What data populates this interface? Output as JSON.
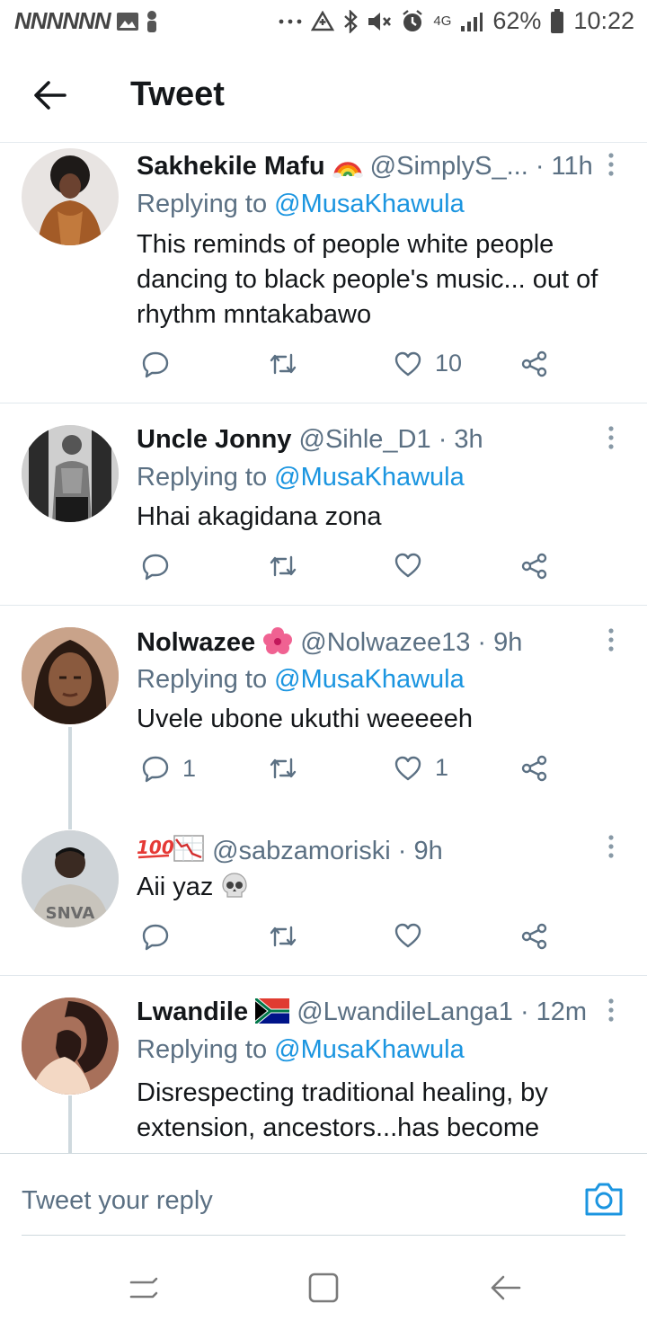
{
  "status_bar": {
    "carrier_marks": "NNNNNN",
    "signal": "4G",
    "battery": "62%",
    "time": "10:22",
    "icons": [
      "gallery-icon",
      "person-icon",
      "more-dots-icon",
      "data-saver-icon",
      "bluetooth-icon",
      "mute-icon",
      "alarm-icon",
      "signal-icon",
      "battery-icon"
    ]
  },
  "app_bar": {
    "title": "Tweet",
    "back_icon": "arrow-left-icon"
  },
  "tweets": [
    {
      "name": "Sakhekile Mafu",
      "name_emoji": "rainbow-emoji",
      "handle": "@SimplyS_...",
      "time": "· 11h",
      "reply_prefix": "Replying to",
      "reply_to": "@MusaKhawula",
      "text": "This reminds of people white people dancing to black people's music... out of rhythm mntakabawo",
      "replies": "",
      "retweets": "",
      "likes": "10"
    },
    {
      "name": "Uncle Jonny",
      "handle": "@Sihle_D1",
      "time": "· 3h",
      "reply_prefix": "Replying to",
      "reply_to": "@MusaKhawula",
      "text": "Hhai akagidana zona",
      "replies": "",
      "retweets": "",
      "likes": ""
    },
    {
      "name": "Nolwazee",
      "name_emoji": "hibiscus-emoji",
      "handle": "@Nolwazee13",
      "time": "· 9h",
      "reply_prefix": "Replying to",
      "reply_to": "@MusaKhawula",
      "text": "Uvele ubone ukuthi weeeeeh",
      "replies": "1",
      "retweets": "",
      "likes": "1"
    },
    {
      "name": "",
      "name_emoji": "hundred-points-and-chart-decreasing-emoji",
      "handle": "@sabzamoriski",
      "time": "· 9h",
      "text": "Aii yaz",
      "text_emoji": "skull-emoji",
      "replies": "",
      "retweets": "",
      "likes": ""
    },
    {
      "name": "Lwandile",
      "name_emoji": "south-africa-flag-emoji",
      "handle": "@LwandileLanga1",
      "time": "· 12m",
      "reply_prefix": "Replying to",
      "reply_to": "@MusaKhawula",
      "text": "Disrespecting traditional healing, by extension, ancestors...has become"
    }
  ],
  "composer": {
    "placeholder": "Tweet your reply",
    "camera_icon": "camera-icon"
  },
  "nav_bar": {
    "icons": [
      "recent-apps-icon",
      "home-icon",
      "back-icon"
    ]
  },
  "colors": {
    "link": "#1b95e0",
    "secondary_text": "#5b7083",
    "divider": "#e1e8ed",
    "background": "#ffffff"
  }
}
